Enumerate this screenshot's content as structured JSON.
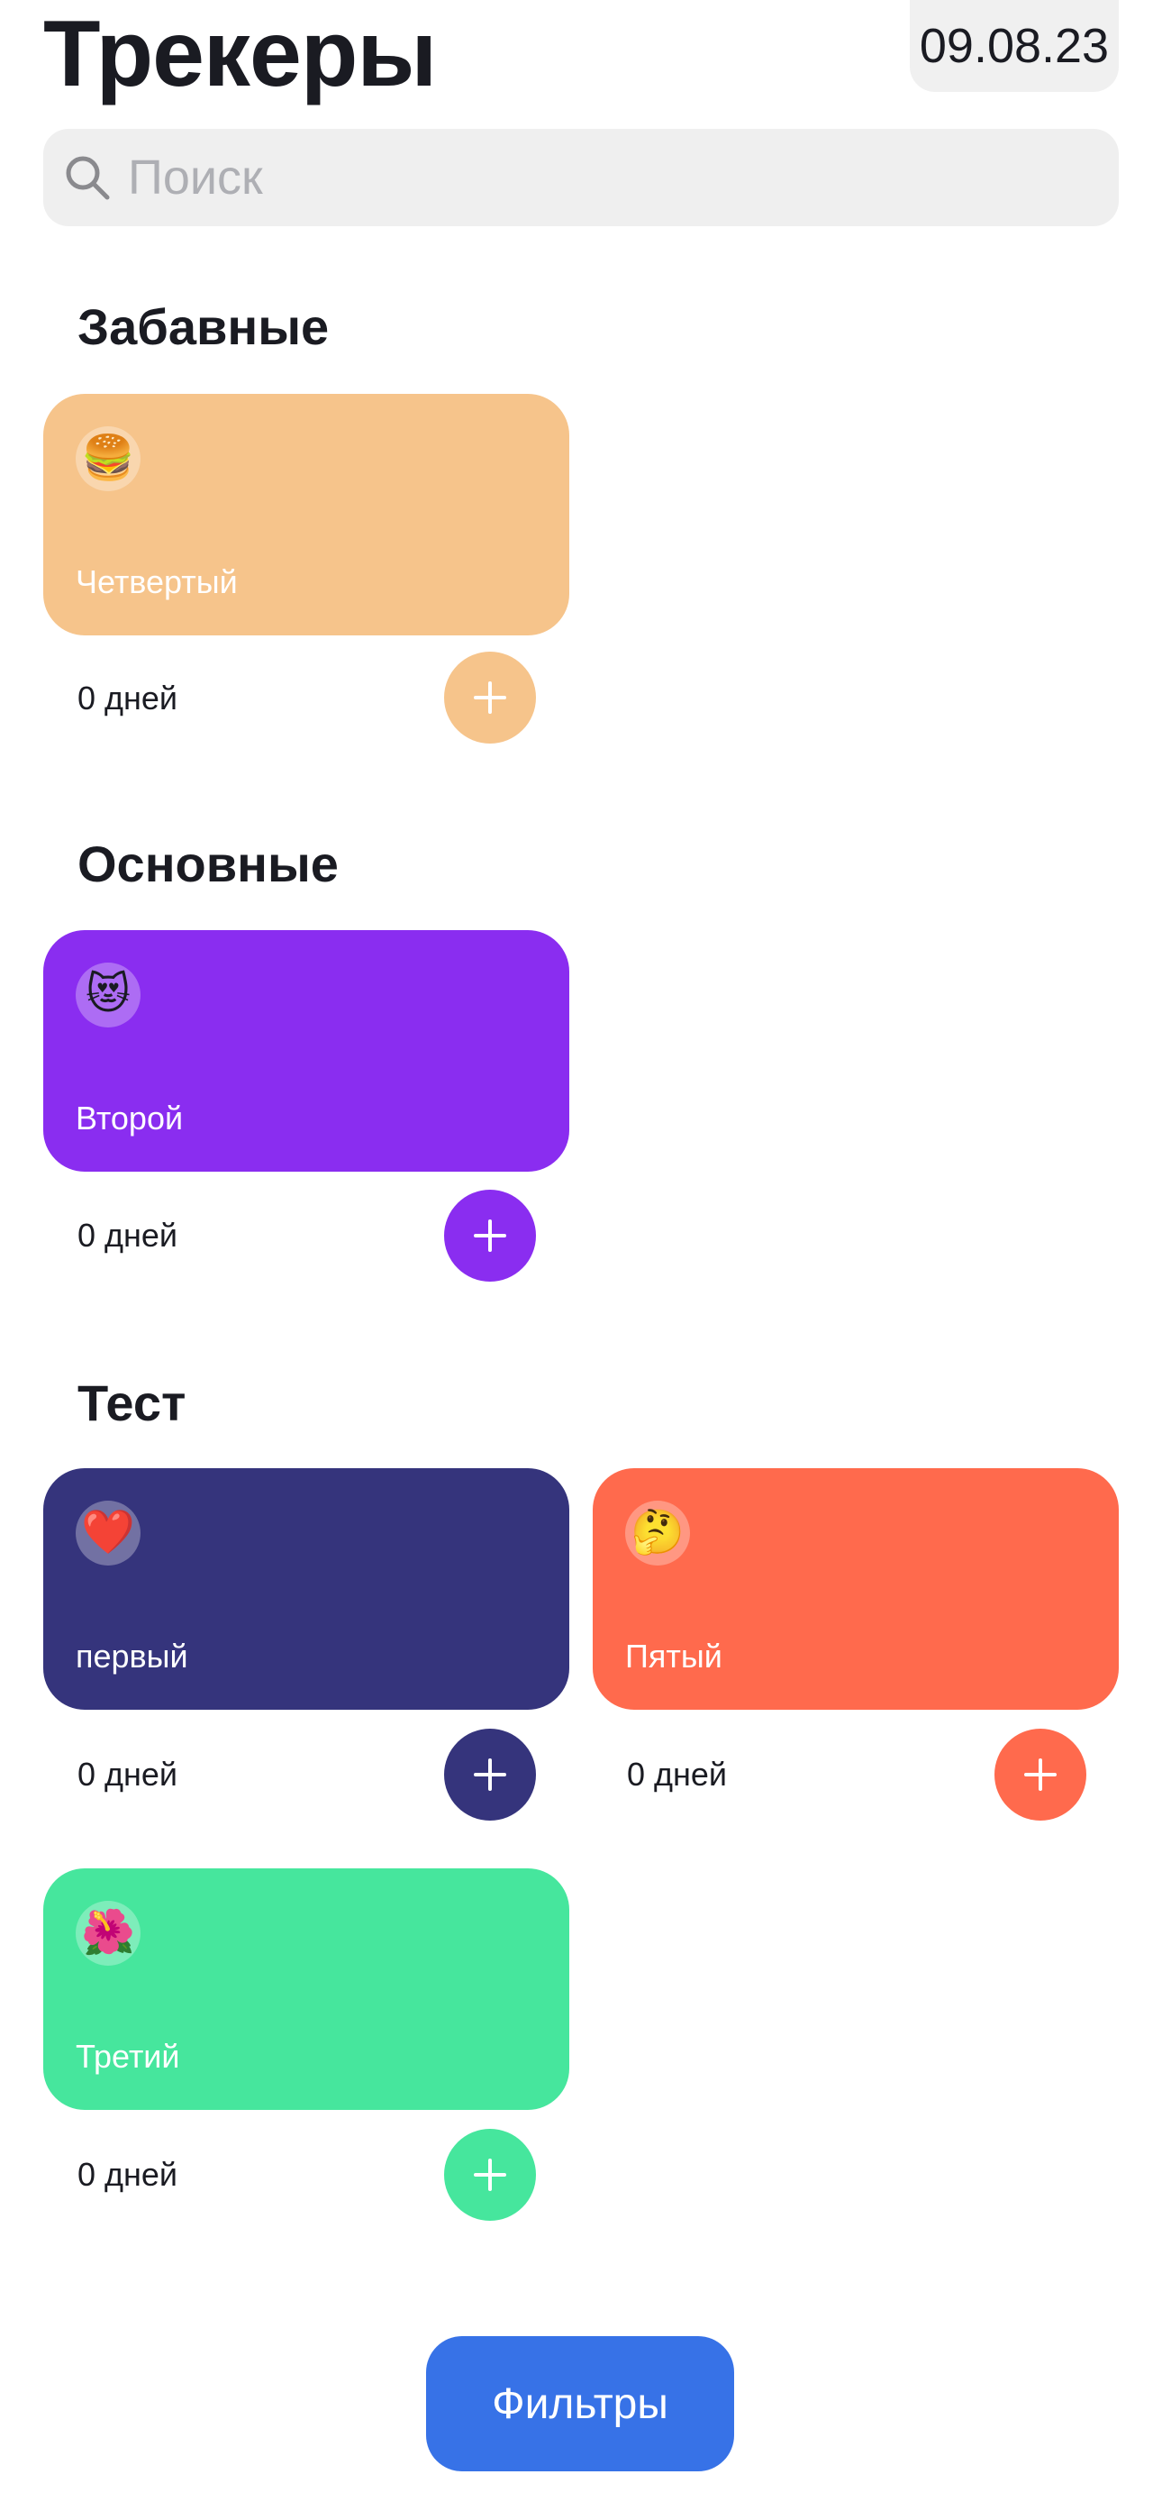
{
  "header": {
    "title": "Трекеры",
    "date": "09.08.23"
  },
  "search": {
    "placeholder": "Поиск",
    "icon": "search-icon"
  },
  "sections": [
    {
      "title": "Забавные",
      "trackers": [
        {
          "name": "Четвертый",
          "emoji": "🍔",
          "days": "0 дней",
          "color": "#F6C48B"
        }
      ]
    },
    {
      "title": "Основные",
      "trackers": [
        {
          "name": "Второй",
          "emoji": "😻",
          "days": "0 дней",
          "color": "#8A2DF0"
        }
      ]
    },
    {
      "title": "Тест",
      "trackers": [
        {
          "name": "первый",
          "emoji": "❤️",
          "days": "0 дней",
          "color": "#35347C"
        },
        {
          "name": "Пятый",
          "emoji": "🤔",
          "days": "0 дней",
          "color": "#FF6A4D"
        },
        {
          "name": "Третий",
          "emoji": "🌺",
          "days": "0 дней",
          "color": "#46E69D"
        }
      ]
    }
  ],
  "footer": {
    "filter_label": "Фильтры",
    "accent": "#3772E7"
  }
}
